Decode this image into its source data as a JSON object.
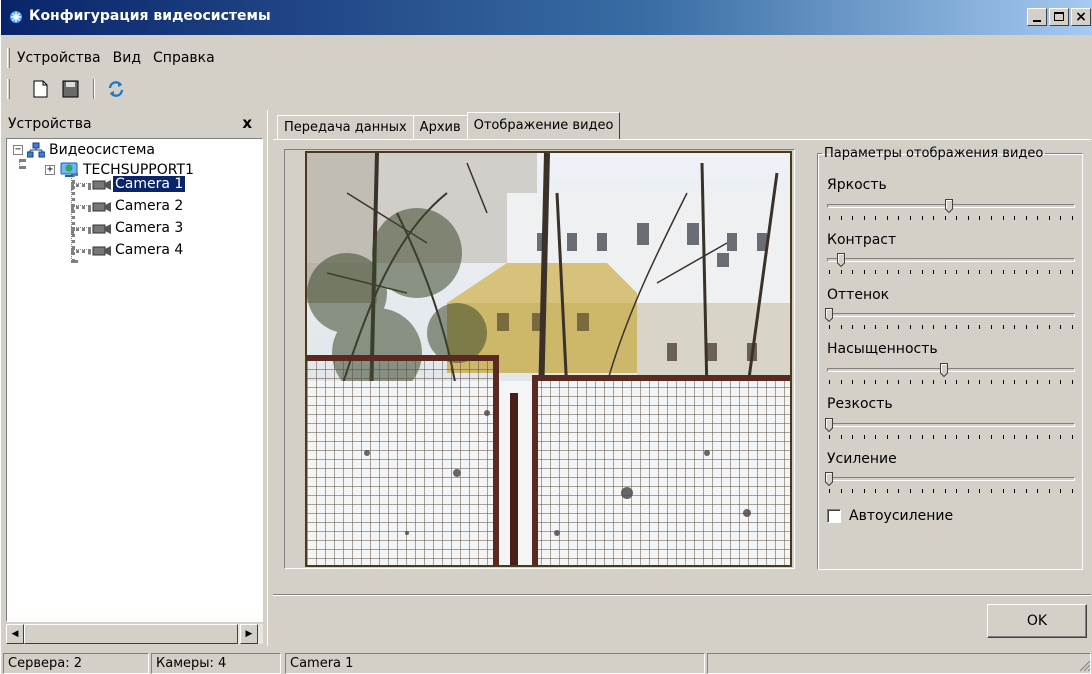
{
  "window": {
    "title": "Конфигурация видеосистемы",
    "app_icon": "snowflake-icon",
    "controls": {
      "minimize": "minimize-icon",
      "maximize": "maximize-icon",
      "close": "×"
    }
  },
  "menu": [
    "Устройства",
    "Вид",
    "Справка"
  ],
  "toolbar": [
    "new-document-icon",
    "save-icon",
    "refresh-icon"
  ],
  "devices_panel": {
    "title": "Устройства",
    "close": "x",
    "tree": {
      "root": "Видеосистема",
      "server": "TECHSUPPORT1",
      "cameras": [
        "Camera 1",
        "Camera 2",
        "Camera 3",
        "Camera 4"
      ],
      "selected": "Camera 1"
    }
  },
  "tabs": [
    "Передача данных",
    "Архив",
    "Отображение видео"
  ],
  "active_tab": "Отображение видео",
  "video_params": {
    "group_title": "Параметры отображения видео",
    "sliders": [
      {
        "label": "Яркость",
        "value": 0.5
      },
      {
        "label": "Контраст",
        "value": 0.05
      },
      {
        "label": "Оттенок",
        "value": 0.0
      },
      {
        "label": "Насыщенность",
        "value": 0.48
      },
      {
        "label": "Резкость",
        "value": 0.0
      },
      {
        "label": "Усиление",
        "value": 0.0
      }
    ],
    "auto_gain_label": "Автоусиление",
    "auto_gain_checked": false
  },
  "ok_label": "OK",
  "status": {
    "servers": "Сервера: 2",
    "cameras": "Камеры: 4",
    "selected": "Camera 1"
  },
  "colors": {
    "title_bar": "#0a246a",
    "selection": "#0a246a",
    "face": "#d4d0c8"
  }
}
